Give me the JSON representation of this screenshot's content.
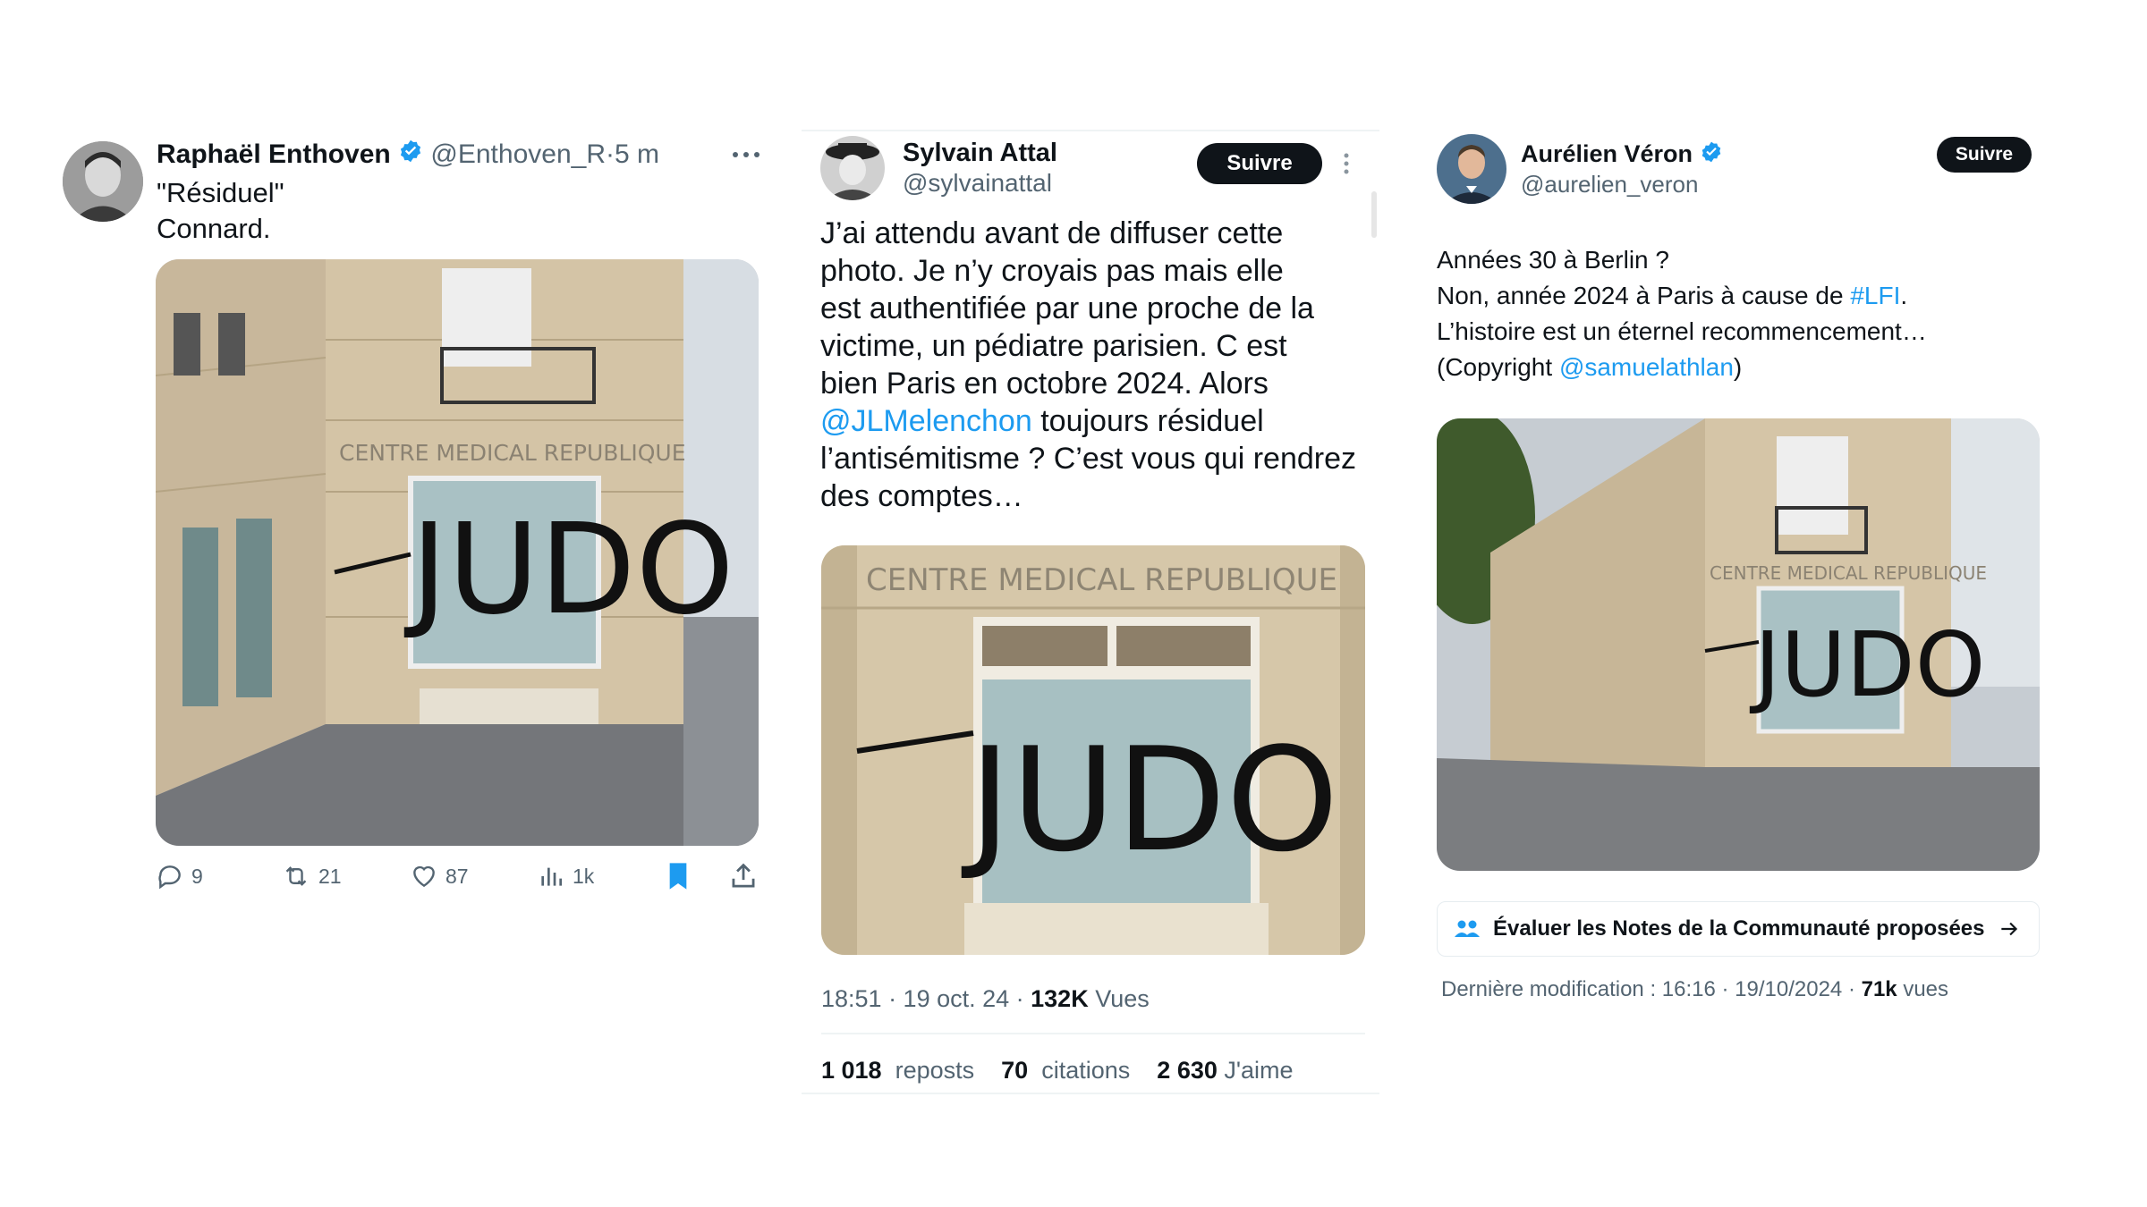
{
  "tweet1": {
    "name": "Raphaël Enthoven",
    "handle": "@Enthoven_R",
    "time": "5 m",
    "text_line1": "\"Résiduel\"",
    "text_line2": "Connard.",
    "photo_sign": "CENTRE MEDICAL REPUBLIQUE",
    "graffiti": "JUDO",
    "actions": {
      "replies": "9",
      "reposts": "21",
      "likes": "87",
      "views": "1k"
    }
  },
  "tweet2": {
    "name": "Sylvain Attal",
    "handle": "@sylvainattal",
    "follow_label": "Suivre",
    "text_lines": [
      "J’ai attendu avant de diffuser cette",
      "photo. Je n’y croyais pas mais elle",
      "est authentifiée par une proche de la",
      "victime, un pédiatre parisien. C est",
      "bien Paris en octobre 2024. Alors"
    ],
    "mention": "@JLMelenchon",
    "mention_after": " toujours résiduel",
    "text_line7": "l’antisémitisme ? C’est vous qui rendrez",
    "text_line8": "des comptes…",
    "photo_sign": "CENTRE MEDICAL REPUBLIQUE",
    "graffiti": "JUDO",
    "meta_time": "18:51 · 19 oct. 24 · ",
    "meta_views_count": "132K",
    "meta_views_label": " Vues",
    "stats": {
      "reposts_count": "1 018",
      "reposts_label": "reposts",
      "quotes_count": "70",
      "quotes_label": "citations",
      "likes_count": "2 630",
      "likes_label": "J'aime"
    }
  },
  "tweet3": {
    "name": "Aurélien Véron",
    "handle": "@aurelien_veron",
    "follow_label": "Suivre",
    "line1": "Années 30 à Berlin ?",
    "line2_before": "Non, année 2024 à Paris à cause de ",
    "line2_link": "#LFI",
    "line2_after": ".",
    "line3": "L’histoire est un éternel recommencement…",
    "line4_before": "(Copyright ",
    "line4_link": "@samuelathlan",
    "line4_after": ")",
    "photo_sign": "CENTRE MEDICAL REPUBLIQUE",
    "graffiti": "JUDO",
    "community_notes_label": "Évaluer les Notes de la Communauté proposées",
    "meta_prefix": "Dernière modification : 16:16 · 19/10/2024 · ",
    "meta_views_count": "71k",
    "meta_views_label": " vues"
  },
  "colors": {
    "link": "#1d9bf0",
    "verified": "#1d9bf0",
    "text": "#0f1419",
    "muted": "#536471",
    "bookmark": "#1d9bf0"
  }
}
